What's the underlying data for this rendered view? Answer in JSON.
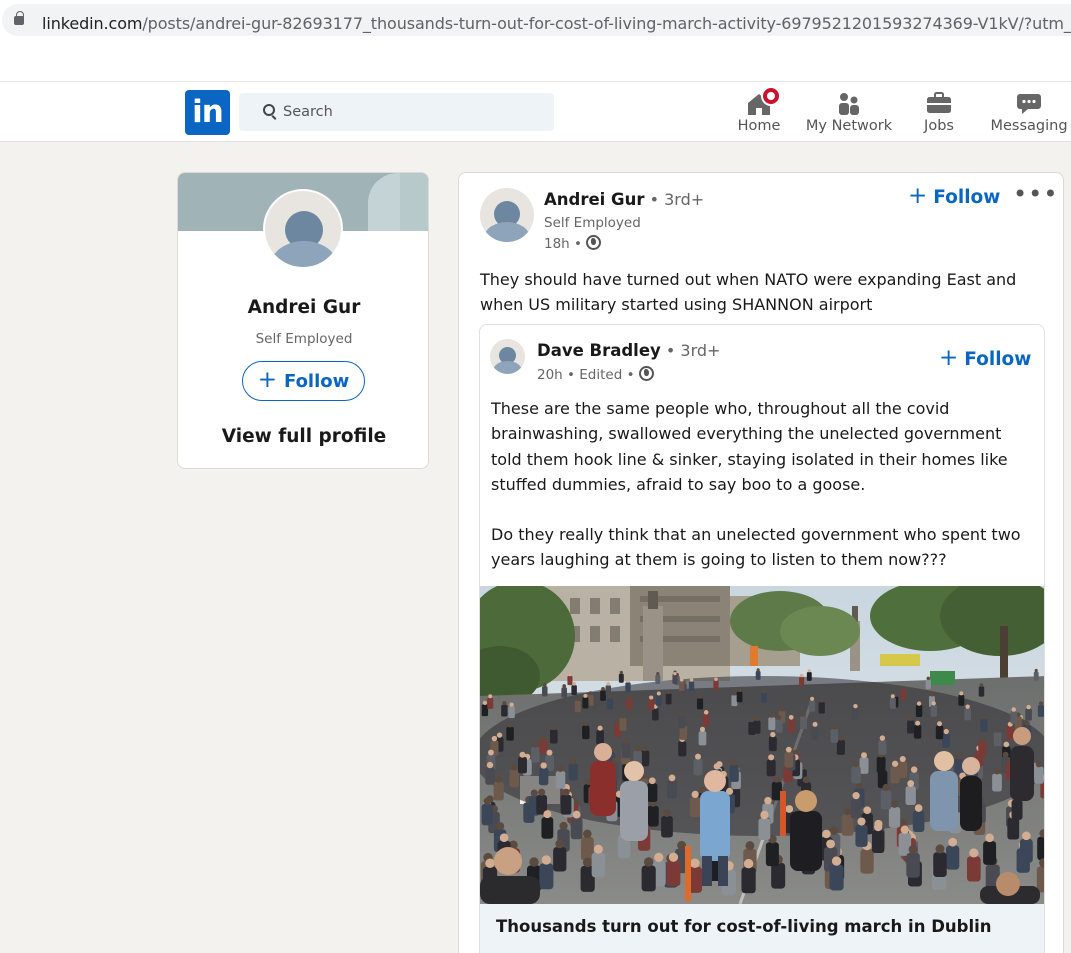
{
  "browser": {
    "url_domain": "linkedin.com",
    "url_path": "/posts/andrei-gur-82693177_thousands-turn-out-for-cost-of-living-march-activity-6979521201593274369-V1kV/?utm_so"
  },
  "nav": {
    "search_placeholder": "Search",
    "items": [
      {
        "label": "Home",
        "icon": "home-icon",
        "badge": true
      },
      {
        "label": "My Network",
        "icon": "network-icon"
      },
      {
        "label": "Jobs",
        "icon": "briefcase-icon"
      },
      {
        "label": "Messaging",
        "icon": "message-icon"
      }
    ],
    "accent": "#0a66c2",
    "badge_color": "#cb112d"
  },
  "profile_card": {
    "name": "Andrei Gur",
    "headline": "Self Employed",
    "follow_label": "Follow",
    "view_profile_label": "View full profile"
  },
  "post": {
    "author": "Andrei Gur",
    "degree": "• 3rd+",
    "headline": "Self Employed",
    "time": "18h •",
    "follow_label": "Follow",
    "text": "They should have turned out when NATO were expanding East and when US military started using SHANNON airport",
    "reshared": {
      "author": "Dave Bradley",
      "degree": "• 3rd+",
      "time": "20h • Edited •",
      "follow_label": "Follow",
      "paragraph1": "These are the same people who, throughout all the covid brainwashing, swallowed everything the unelected government told them hook line & sinker, staying isolated in their homes like stuffed dummies, afraid to say boo to a goose.",
      "paragraph2": "Do they really think that an unelected government who spent two years laughing at them is going to listen to them now???",
      "link_title": "Thousands turn out for cost-of-living march in Dublin"
    }
  }
}
